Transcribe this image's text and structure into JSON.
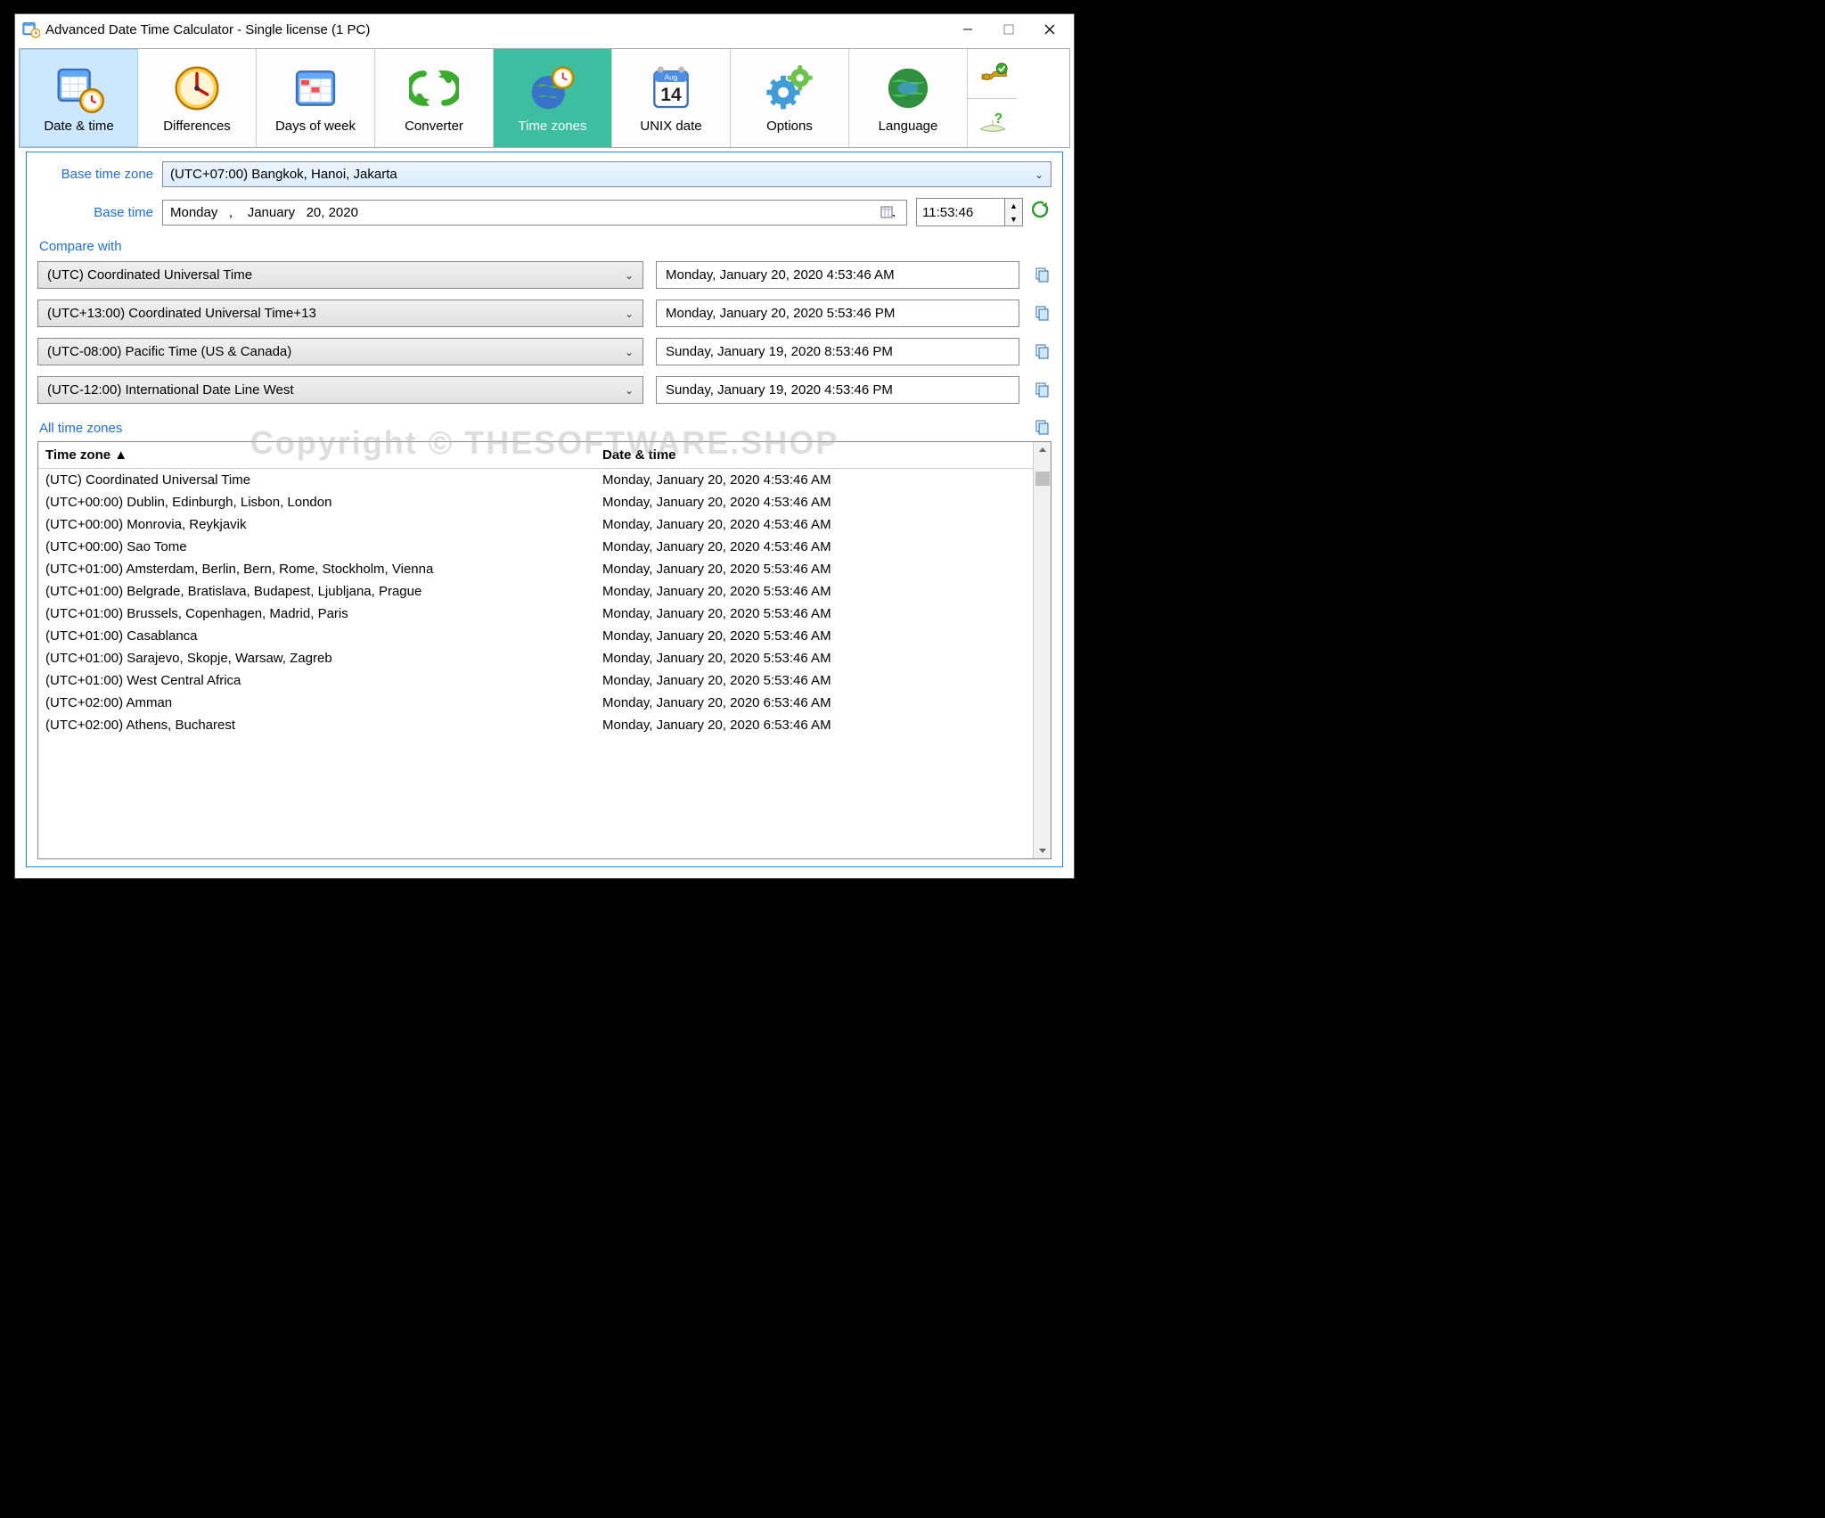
{
  "window": {
    "title": "Advanced Date Time Calculator - Single license (1 PC)"
  },
  "watermark": "Copyright © THESOFTWARE.SHOP",
  "toolbar": {
    "date_time": "Date & time",
    "differences": "Differences",
    "days_of_week": "Days of week",
    "converter": "Converter",
    "time_zones": "Time zones",
    "unix_date": "UNIX date",
    "options": "Options",
    "language": "Language"
  },
  "labels": {
    "base_time_zone": "Base time zone",
    "base_time": "Base time",
    "compare_with": "Compare with",
    "all_time_zones": "All time zones",
    "col_zone": "Time zone ▲",
    "col_dt": "Date & time"
  },
  "base": {
    "zone": "(UTC+07:00) Bangkok, Hanoi, Jakarta",
    "date": "Monday   ,    January   20, 2020",
    "time": "11:53:46"
  },
  "compare": [
    {
      "zone": "(UTC) Coordinated Universal Time",
      "result": "Monday, January 20, 2020 4:53:46 AM"
    },
    {
      "zone": "(UTC+13:00) Coordinated Universal Time+13",
      "result": "Monday, January 20, 2020 5:53:46 PM"
    },
    {
      "zone": "(UTC-08:00) Pacific Time (US & Canada)",
      "result": "Sunday, January 19, 2020 8:53:46 PM"
    },
    {
      "zone": "(UTC-12:00) International Date Line West",
      "result": "Sunday, January 19, 2020 4:53:46 PM"
    }
  ],
  "allzones": [
    {
      "zone": "(UTC) Coordinated Universal Time",
      "dt": "Monday, January 20, 2020 4:53:46 AM"
    },
    {
      "zone": "(UTC+00:00) Dublin, Edinburgh, Lisbon, London",
      "dt": "Monday, January 20, 2020 4:53:46 AM"
    },
    {
      "zone": "(UTC+00:00) Monrovia, Reykjavik",
      "dt": "Monday, January 20, 2020 4:53:46 AM"
    },
    {
      "zone": "(UTC+00:00) Sao Tome",
      "dt": "Monday, January 20, 2020 4:53:46 AM"
    },
    {
      "zone": "(UTC+01:00) Amsterdam, Berlin, Bern, Rome, Stockholm, Vienna",
      "dt": "Monday, January 20, 2020 5:53:46 AM"
    },
    {
      "zone": "(UTC+01:00) Belgrade, Bratislava, Budapest, Ljubljana, Prague",
      "dt": "Monday, January 20, 2020 5:53:46 AM"
    },
    {
      "zone": "(UTC+01:00) Brussels, Copenhagen, Madrid, Paris",
      "dt": "Monday, January 20, 2020 5:53:46 AM"
    },
    {
      "zone": "(UTC+01:00) Casablanca",
      "dt": "Monday, January 20, 2020 5:53:46 AM"
    },
    {
      "zone": "(UTC+01:00) Sarajevo, Skopje, Warsaw, Zagreb",
      "dt": "Monday, January 20, 2020 5:53:46 AM"
    },
    {
      "zone": "(UTC+01:00) West Central Africa",
      "dt": "Monday, January 20, 2020 5:53:46 AM"
    },
    {
      "zone": "(UTC+02:00) Amman",
      "dt": "Monday, January 20, 2020 6:53:46 AM"
    },
    {
      "zone": "(UTC+02:00) Athens, Bucharest",
      "dt": "Monday, January 20, 2020 6:53:46 AM"
    }
  ]
}
